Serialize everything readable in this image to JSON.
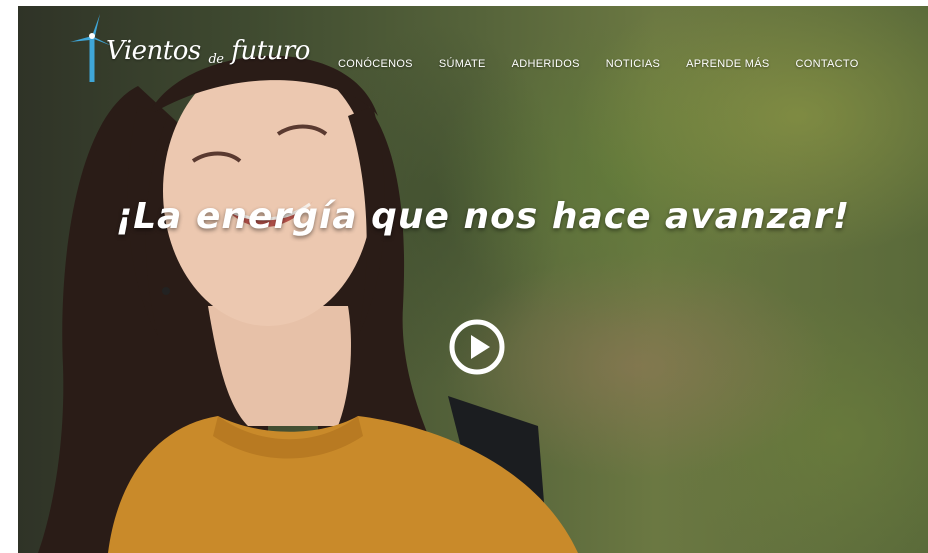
{
  "header": {
    "logo": {
      "brand_main": "Vientos",
      "brand_small": "de",
      "brand_tail": "futuro",
      "icon": "wind-turbine-icon"
    },
    "nav": [
      {
        "label": "CONÓCENOS"
      },
      {
        "label": "SÚMATE"
      },
      {
        "label": "ADHERIDOS"
      },
      {
        "label": "NOTICIAS"
      },
      {
        "label": "APRENDE MÁS"
      },
      {
        "label": "CONTACTO"
      }
    ]
  },
  "hero": {
    "headline": "¡La energía que nos hace avanzar!",
    "play_icon": "play-circle-icon"
  },
  "colors": {
    "text": "#ffffff",
    "logo_accent": "#3fa6d8",
    "sweater": "#c98a2a"
  }
}
